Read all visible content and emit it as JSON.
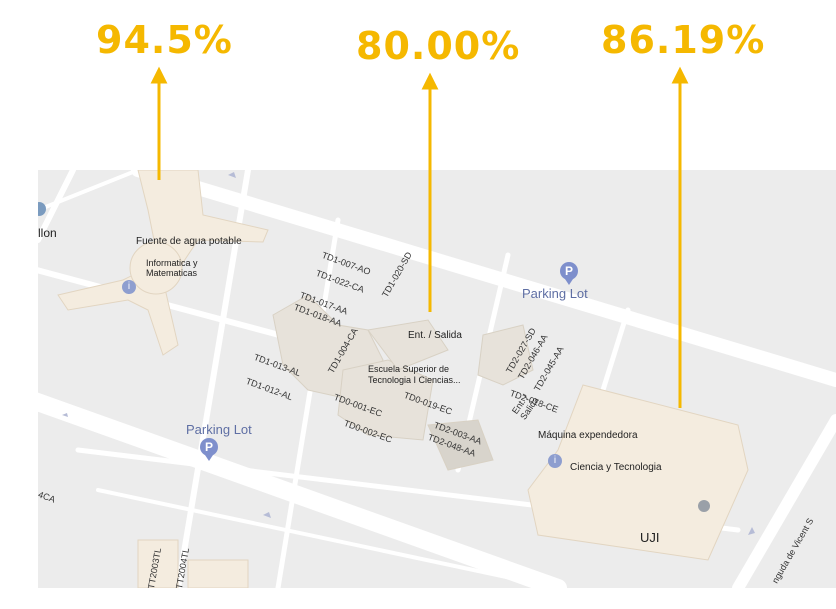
{
  "percentages": [
    "94.5%",
    "80.00%",
    "86.19%"
  ],
  "map": {
    "edge_label": "llon",
    "fuente": "Fuente de agua potable",
    "informatica": "Informatica y\nMatematicas",
    "parking1": "Parking Lot",
    "parking2": "Parking Lot",
    "ent_salida": "Ent. / Salida",
    "escuela": "Escuela Superior de\nTecnologia I Ciencias...",
    "maquina": "Máquina expendedora",
    "ciencia": "Ciencia y Tecnologia",
    "uji": "UJI",
    "ent_salida2": "Ent. /\nSalida",
    "road_label": "nguda de Vicent S",
    "edge_code": "4CA",
    "rooms": [
      "TD1-007-AO",
      "TD1-020-SD",
      "TD1-022-CA",
      "TD1-017-AA",
      "TD1-018-AA",
      "TD1-004-CA",
      "TD1-013-AL",
      "TD1-012-AL",
      "TD0-001-EC",
      "TD0-002-EC",
      "TD0-019-EC",
      "TD2-027-SD",
      "TD2-046-AA",
      "TD2-045-AA",
      "TD2-018-CE",
      "TD2-003-AA",
      "TD2-048-AA",
      "TT2003TL",
      "TT2004TL"
    ]
  },
  "colors": {
    "accent": "#F5B800",
    "road": "#ffffff",
    "ground": "#ececec",
    "building": "#f4ecdf"
  }
}
